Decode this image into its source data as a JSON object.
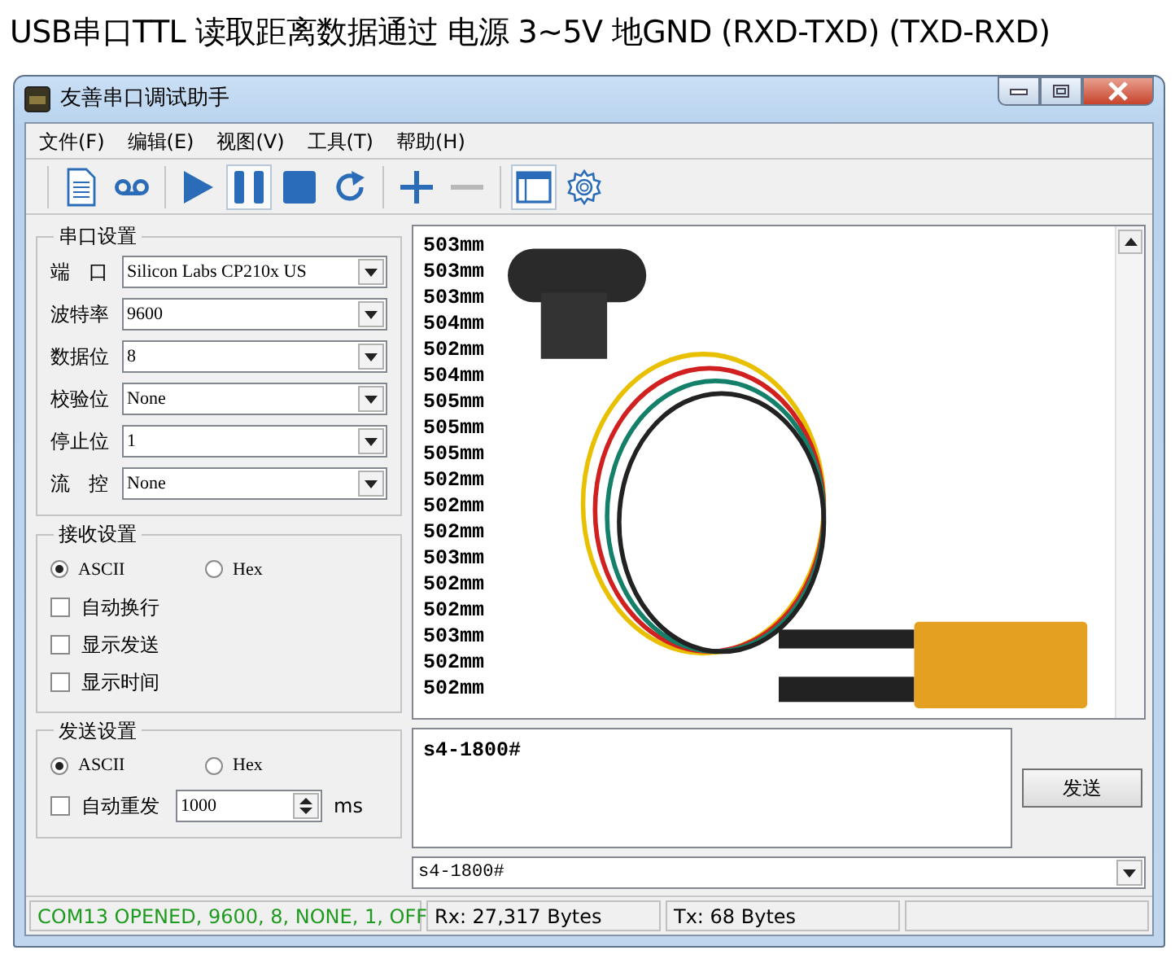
{
  "heading": "USB串口TTL 读取距离数据通过 电源 3~5V 地GND (RXD-TXD) (TXD-RXD)",
  "window": {
    "title": "友善串口调试助手"
  },
  "menu": [
    "文件(F)",
    "编辑(E)",
    "视图(V)",
    "工具(T)",
    "帮助(H)"
  ],
  "toolbar": [
    {
      "kind": "document",
      "selected": false,
      "disabled": false
    },
    {
      "kind": "record",
      "selected": false,
      "disabled": false
    },
    {
      "kind": "play",
      "selected": false,
      "disabled": false
    },
    {
      "kind": "pause",
      "selected": true,
      "disabled": false
    },
    {
      "kind": "stop",
      "selected": false,
      "disabled": false
    },
    {
      "kind": "refresh",
      "selected": false,
      "disabled": false
    },
    {
      "kind": "add",
      "selected": false,
      "disabled": false
    },
    {
      "kind": "remove",
      "selected": false,
      "disabled": true
    },
    {
      "kind": "window",
      "selected": true,
      "disabled": false
    },
    {
      "kind": "settings",
      "selected": false,
      "disabled": false
    }
  ],
  "serial_settings": {
    "title": "串口设置",
    "fields": [
      {
        "label": "端 口",
        "value": "Silicon Labs CP210x US"
      },
      {
        "label": "波特率",
        "value": "9600"
      },
      {
        "label": "数据位",
        "value": "8"
      },
      {
        "label": "校验位",
        "value": "None"
      },
      {
        "label": "停止位",
        "value": "1"
      },
      {
        "label": "流 控",
        "value": "None"
      }
    ]
  },
  "receive_settings": {
    "title": "接收设置",
    "modes": [
      {
        "label": "ASCII",
        "selected": true
      },
      {
        "label": "Hex",
        "selected": false
      }
    ],
    "options": [
      {
        "label": "自动换行",
        "checked": false
      },
      {
        "label": "显示发送",
        "checked": false
      },
      {
        "label": "显示时间",
        "checked": false
      }
    ]
  },
  "send_settings": {
    "title": "发送设置",
    "modes": [
      {
        "label": "ASCII",
        "selected": true
      },
      {
        "label": "Hex",
        "selected": false
      }
    ],
    "auto_resend": {
      "label": "自动重发",
      "checked": false,
      "value": "1000",
      "unit": "ms"
    }
  },
  "receive_lines": [
    "503mm",
    "503mm",
    "503mm",
    "504mm",
    "502mm",
    "504mm",
    "505mm",
    "505mm",
    "505mm",
    "502mm",
    "502mm",
    "502mm",
    "503mm",
    "502mm",
    "502mm",
    "503mm",
    "502mm",
    "502mm"
  ],
  "send_text": "s4-1800#",
  "send_button": "发送",
  "history_combo": "s4-1800#",
  "status_bar": [
    "COM13 OPENED, 9600, 8, NONE, 1, OFF",
    "Rx: 27,317 Bytes",
    "Tx: 68 Bytes"
  ]
}
